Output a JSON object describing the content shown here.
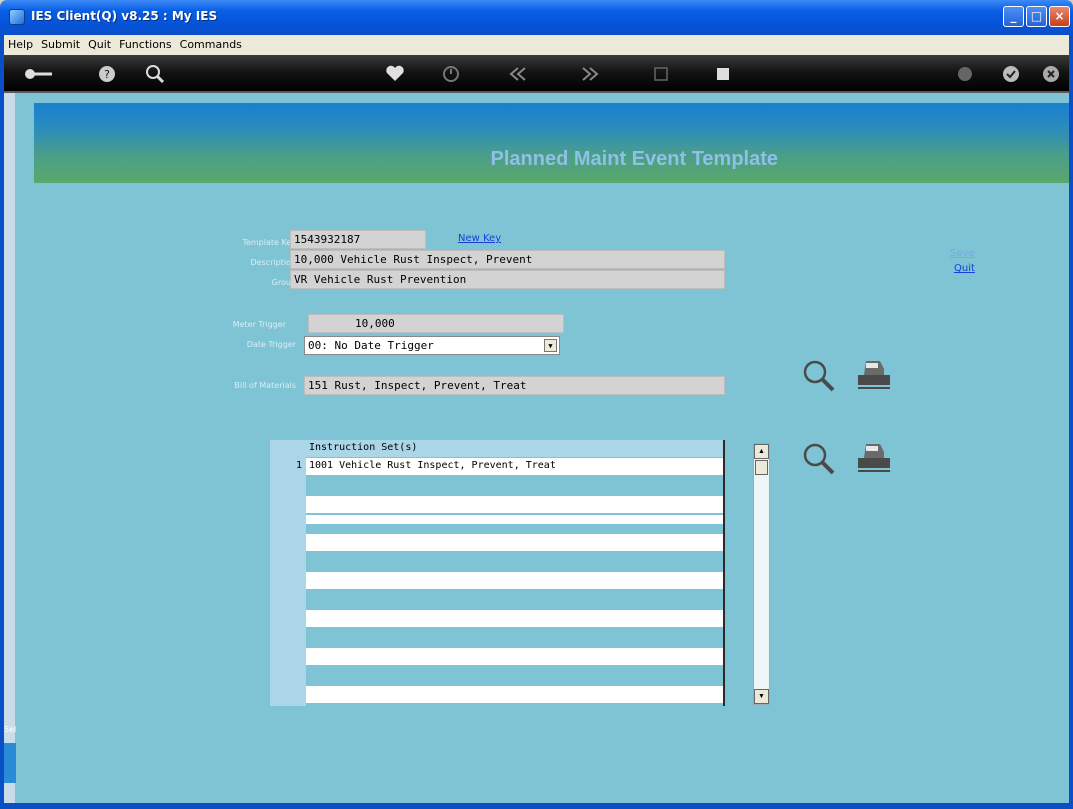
{
  "window": {
    "title": "IES Client(Q) v8.25 : My IES",
    "min": "_",
    "max": "□",
    "close": "×"
  },
  "menu": [
    "Help",
    "Submit",
    "Quit",
    "Functions",
    "Commands"
  ],
  "colors": {
    "titlebar": "#0553d8",
    "content_bg": "#7ec4d4",
    "link": "#1a3fd8",
    "banner_text": "#8ec0e8"
  },
  "toolbar": {
    "icons": [
      "key-icon",
      "help-icon",
      "search-icon",
      "heart-icon",
      "clock-icon",
      "rewind-icon",
      "forward-icon",
      "tab-icon",
      "stop-icon",
      "info-icon",
      "check-icon",
      "close-icon"
    ]
  },
  "page": {
    "heading": "Planned Maint Event Template"
  },
  "actions": {
    "save": "Save",
    "quit": "Quit",
    "new_key": "New Key"
  },
  "form": {
    "template_key_label": "Template Key",
    "template_key": "1543932187",
    "description_label": "Description",
    "description": "10,000 Vehicle Rust Inspect, Prevent",
    "group_label": "Group",
    "group": "VR Vehicle Rust Prevention",
    "meter_trigger_label": "Meter Trigger",
    "meter_trigger": "10,000",
    "date_trigger_label": "Date Trigger",
    "date_trigger": "00: No Date Trigger",
    "bom_label": "Bill of Materials",
    "bom": "151 Rust, Inspect, Prevent, Treat"
  },
  "grid": {
    "header": "Instruction Set(s)",
    "rows": [
      {
        "num": "1",
        "text": "1001 Vehicle Rust Inspect, Prevent, Treat"
      }
    ]
  },
  "sidebar": {
    "sel_label": "Sel"
  }
}
